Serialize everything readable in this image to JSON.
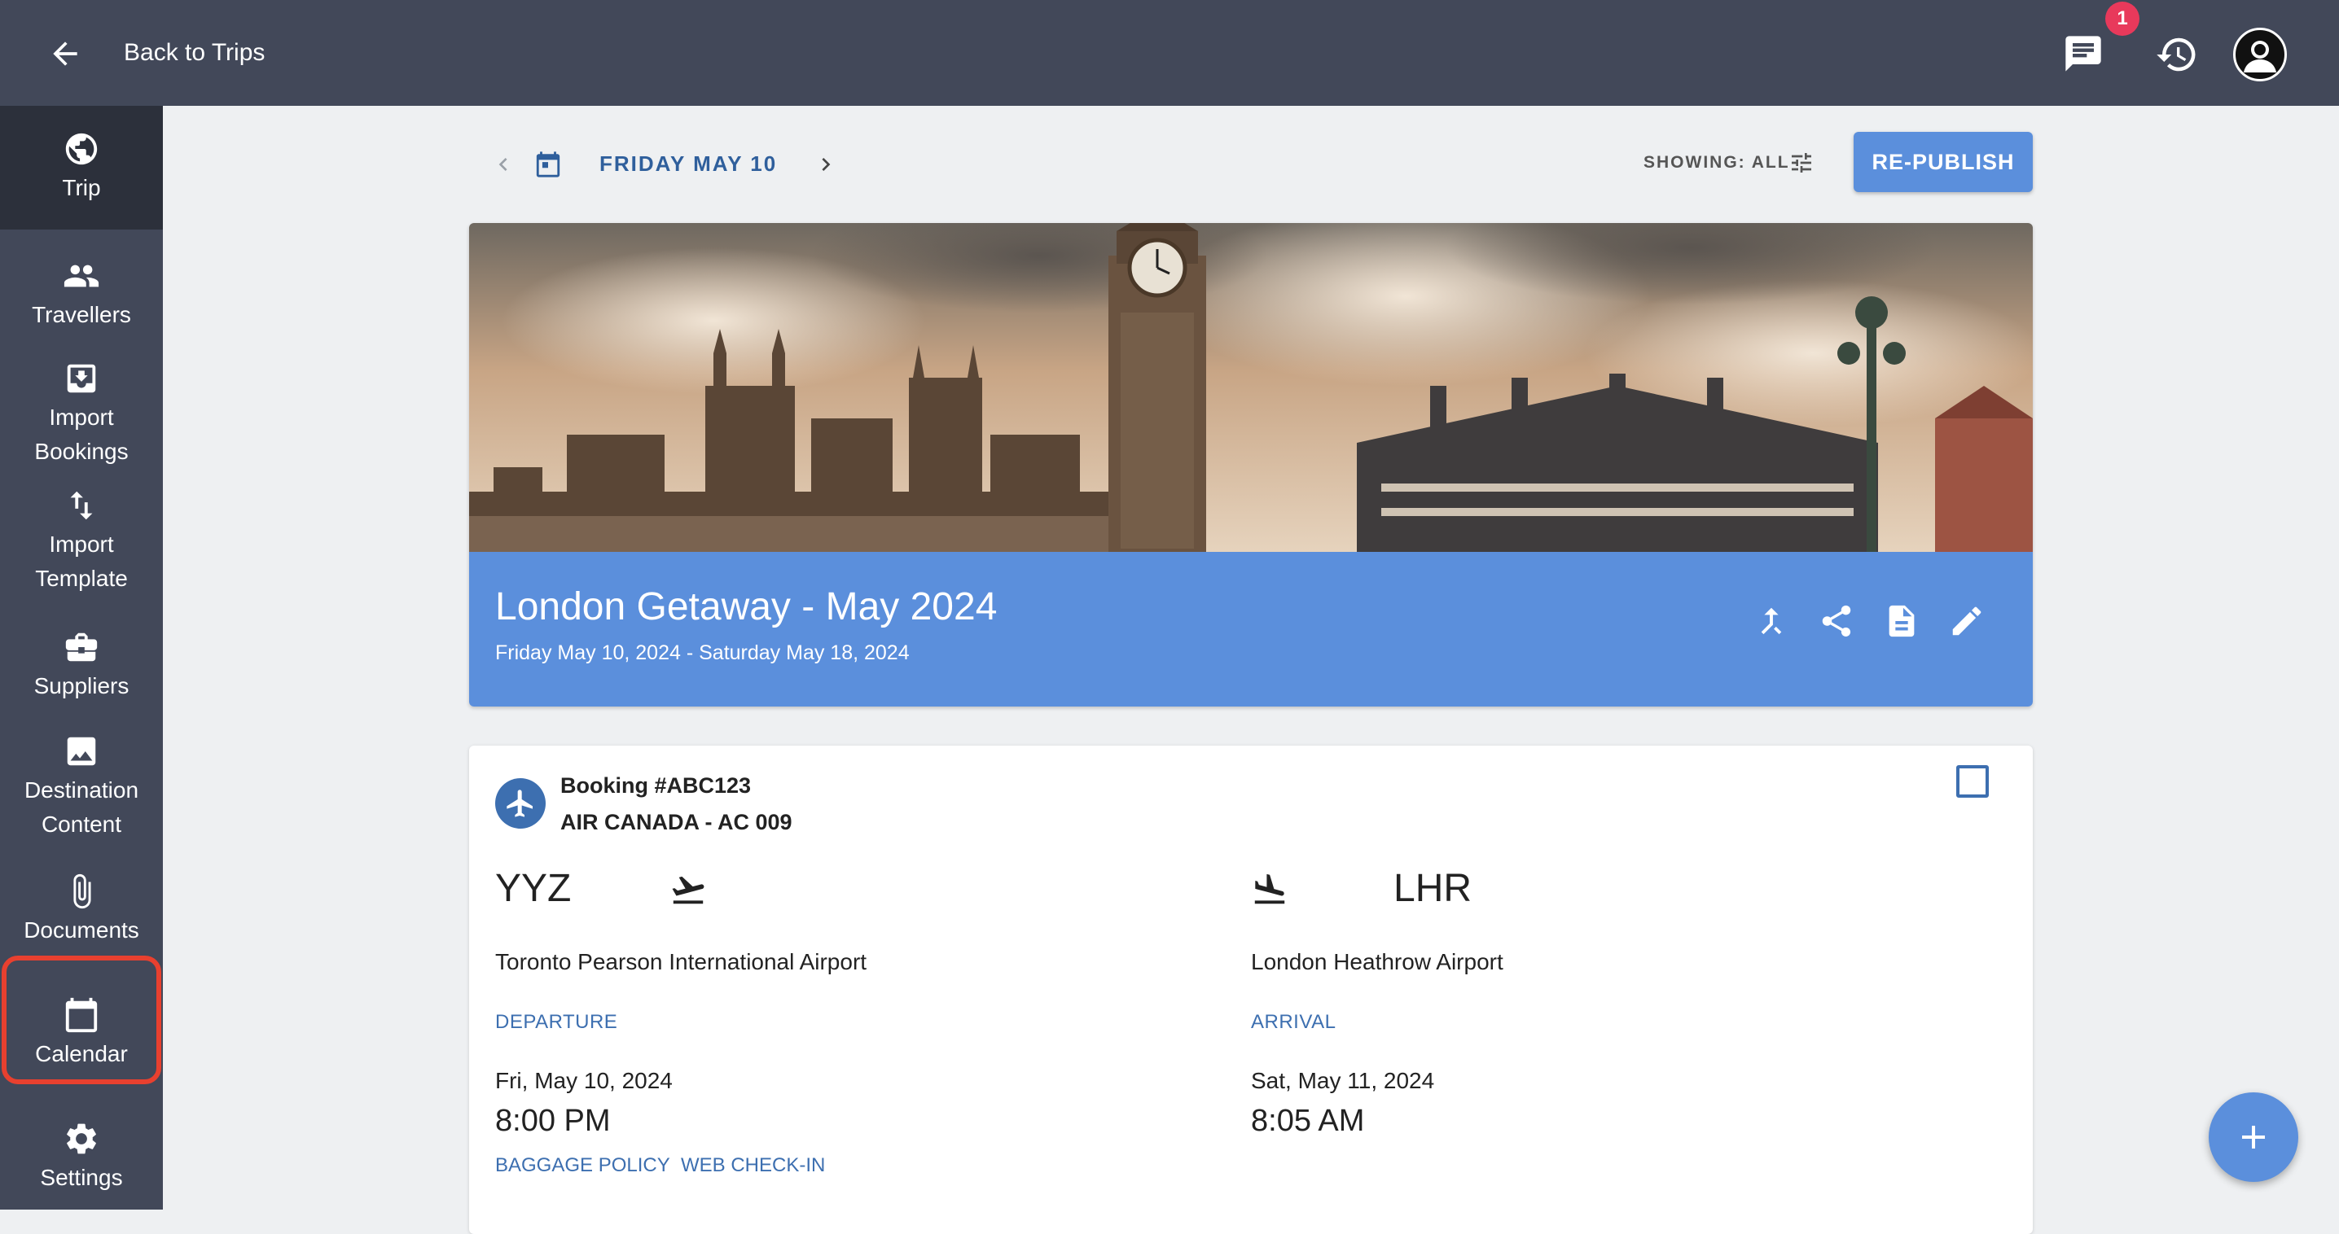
{
  "topbar": {
    "back_label": "Back to Trips",
    "notification_count": "1"
  },
  "sidebar": {
    "items": [
      {
        "label": "Trip",
        "icon": "globe-icon"
      },
      {
        "label": "Travellers",
        "icon": "people-icon"
      },
      {
        "label": "Import Bookings",
        "icon": "download-box-icon"
      },
      {
        "label": "Import Template",
        "icon": "swap-vertical-icon"
      },
      {
        "label": "Suppliers",
        "icon": "briefcase-icon"
      },
      {
        "label": "Destination Content",
        "icon": "image-icon"
      },
      {
        "label": "Documents",
        "icon": "paperclip-icon"
      },
      {
        "label": "Calendar",
        "icon": "calendar-icon"
      },
      {
        "label": "Settings",
        "icon": "gear-icon"
      }
    ]
  },
  "datebar": {
    "date": "FRIDAY MAY 10",
    "showing": "SHOWING: ALL",
    "republish_label": "RE-PUBLISH"
  },
  "trip": {
    "title": "London Getaway - May 2024",
    "dates": "Friday May 10, 2024 - Saturday May 18, 2024"
  },
  "booking": {
    "number": "Booking #ABC123",
    "airline": "AIR CANADA - AC 009",
    "departure": {
      "code": "YYZ",
      "airport": "Toronto Pearson International Airport",
      "label": "DEPARTURE",
      "date": "Fri, May 10, 2024",
      "time": "8:00 PM"
    },
    "arrival": {
      "code": "LHR",
      "airport": "London Heathrow Airport",
      "label": "ARRIVAL",
      "date": "Sat, May 11, 2024",
      "time": "8:05 AM"
    },
    "links": {
      "baggage": "BAGGAGE POLICY",
      "checkin": "WEB CHECK-IN"
    }
  },
  "colors": {
    "header": "#424859",
    "accent": "#5b8fdc",
    "link": "#3d6fb0",
    "badge": "#e8395b",
    "highlight": "#e8402f"
  }
}
